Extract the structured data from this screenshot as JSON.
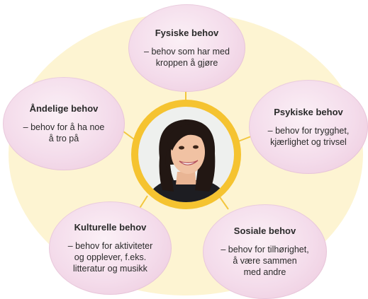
{
  "diagram": {
    "accent_color": "#f5c330",
    "bubble_color": "#f1d3e5",
    "center": {
      "icon": "person-portrait-icon"
    },
    "nodes": {
      "fysiske": {
        "title": "Fysiske behov",
        "desc": "– behov som har med\nkroppen å gjøre"
      },
      "andelige": {
        "title": "Åndelige behov",
        "desc": "– behov for å ha noe\nå tro på"
      },
      "psykiske": {
        "title": "Psykiske behov",
        "desc": "– behov for trygghet,\nkjærlighet og trivsel"
      },
      "kulturelle": {
        "title": "Kulturelle behov",
        "desc": "– behov for aktiviteter\nog opplever, f.eks.\nlitteratur og musikk"
      },
      "sosiale": {
        "title": "Sosiale behov",
        "desc": "– behov for tilhørighet,\nå være sammen\nmed andre"
      }
    }
  }
}
